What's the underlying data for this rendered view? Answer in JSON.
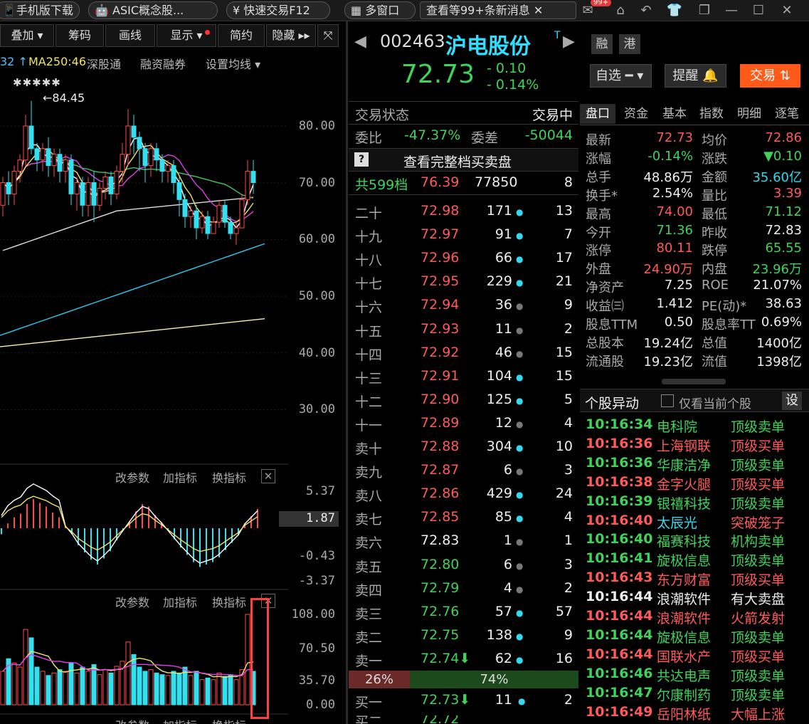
{
  "topbar": {
    "app_download": "手机版下载",
    "concept": "ASIC概念股...",
    "quick_trade": "快速交易F12",
    "multi_window": "多窗口",
    "messages": "查看等99+条新消息",
    "badge": "99+"
  },
  "toolbar": [
    "叠加 ▾",
    "筹码",
    "画线",
    "显示 ▾",
    "简约",
    "隐藏 ▸▸"
  ],
  "chart_header": {
    "ma_partial": "32 ↑",
    "ma250": "MA250:46",
    "sgt": "深股通",
    "margin": "融资融券",
    "set_ma": "设置均线 ▾"
  },
  "chart_data": {
    "type": "candlestick",
    "price_axis": [
      "80.00",
      "70.00",
      "60.00",
      "50.00",
      "40.00",
      "30.00"
    ],
    "high_marker": "84.45",
    "star_marks": "✱✱✱✱✱",
    "macd_axis": [
      "5.37",
      "1.87",
      "-0.43",
      "-3.37"
    ],
    "vol_axis": [
      "108.00",
      "70.50",
      "35.70",
      "0.00"
    ],
    "candles": [
      [
        66,
        70,
        64,
        71
      ],
      [
        70,
        68,
        66,
        72
      ],
      [
        68,
        72,
        66,
        73
      ],
      [
        72,
        74,
        70,
        75
      ],
      [
        74,
        80,
        73,
        82
      ],
      [
        80,
        76,
        75,
        84.45
      ],
      [
        76,
        74,
        72,
        77
      ],
      [
        74,
        76,
        72,
        77
      ],
      [
        76,
        73,
        71,
        78
      ],
      [
        73,
        75,
        71,
        76
      ],
      [
        75,
        72,
        70,
        76
      ],
      [
        72,
        74,
        70,
        75
      ],
      [
        74,
        68,
        66,
        75
      ],
      [
        68,
        70,
        65,
        71
      ],
      [
        70,
        66,
        64,
        71
      ],
      [
        66,
        70,
        64,
        71
      ],
      [
        70,
        66,
        63,
        72
      ],
      [
        66,
        69,
        65,
        70
      ],
      [
        69,
        71,
        67,
        72
      ],
      [
        71,
        68,
        66,
        72
      ],
      [
        68,
        72,
        67,
        73
      ],
      [
        72,
        75,
        70,
        77
      ],
      [
        75,
        80,
        73,
        83
      ],
      [
        80,
        78,
        75,
        82
      ],
      [
        78,
        76,
        72,
        79
      ],
      [
        76,
        73,
        70,
        77
      ],
      [
        73,
        76,
        71,
        77
      ],
      [
        76,
        74,
        72,
        77
      ],
      [
        74,
        72,
        70,
        75
      ],
      [
        72,
        73,
        70,
        74
      ],
      [
        73,
        70,
        68,
        74
      ],
      [
        70,
        67,
        64,
        71
      ],
      [
        67,
        64,
        62,
        68
      ],
      [
        64,
        65,
        62,
        66
      ],
      [
        65,
        62,
        60,
        66
      ],
      [
        62,
        64,
        61,
        65
      ],
      [
        64,
        61,
        60,
        65
      ],
      [
        61,
        63,
        61,
        64
      ],
      [
        63,
        66,
        62,
        67
      ],
      [
        66,
        63,
        62,
        67
      ],
      [
        63,
        61,
        60,
        64
      ],
      [
        61,
        62,
        59,
        63
      ],
      [
        62,
        67,
        62,
        68
      ],
      [
        67,
        72,
        66,
        74
      ],
      [
        72,
        70,
        68,
        74
      ]
    ],
    "volumes": [
      40,
      55,
      50,
      45,
      90,
      80,
      45,
      40,
      35,
      38,
      42,
      40,
      50,
      38,
      45,
      40,
      48,
      36,
      42,
      38,
      46,
      52,
      75,
      60,
      45,
      40,
      42,
      38,
      36,
      35,
      40,
      38,
      45,
      35,
      40,
      30,
      32,
      30,
      38,
      34,
      36,
      30,
      42,
      108,
      40
    ],
    "macd_hist": [
      -0.5,
      0.4,
      0.9,
      1.2,
      2.0,
      2.4,
      2.1,
      1.8,
      1.3,
      0.9,
      0.2,
      -0.5,
      -1.4,
      -2.0,
      -2.6,
      -3.0,
      -2.5,
      -1.9,
      -1.0,
      -0.2,
      0.6,
      1.4,
      2.0,
      1.8,
      1.1,
      0.5,
      -0.2,
      -0.9,
      -1.6,
      -2.2,
      -2.8,
      -3.2,
      -3.0,
      -2.8,
      -2.4,
      -1.8,
      -1.2,
      -0.6,
      0.4,
      1.0,
      1.6
    ]
  },
  "indicator_panel": {
    "params": "改参数",
    "add": "加指标",
    "swap": "换指标",
    "close": "✕"
  },
  "stock": {
    "code": "002463",
    "name": "沪电股份",
    "tag": "T",
    "price": "72.73",
    "change": "- 0.10",
    "pct": "- 0.14%",
    "tag_rong": "融",
    "tag_gang": "港"
  },
  "buttons": {
    "watch": "自选",
    "alert": "提醒",
    "trade": "交易"
  },
  "order_head": {
    "status_label": "交易状态",
    "status": "交易中",
    "wb_label": "委比",
    "wb": "-47.37%",
    "wc_label": "委差",
    "wc": "-50044",
    "q": "?",
    "full_book": "查看完整档买卖盘",
    "levels_label": "共599档",
    "levels_price": "76.39",
    "levels_vol": "77850",
    "levels_n": "8"
  },
  "asks": [
    {
      "lv": "二十",
      "p": "72.98",
      "v": "171",
      "n": "13"
    },
    {
      "lv": "十九",
      "p": "72.97",
      "v": "91",
      "n": "7"
    },
    {
      "lv": "十八",
      "p": "72.96",
      "v": "66",
      "n": "17"
    },
    {
      "lv": "十七",
      "p": "72.95",
      "v": "229",
      "n": "21"
    },
    {
      "lv": "十六",
      "p": "72.94",
      "v": "36",
      "n": "9"
    },
    {
      "lv": "十五",
      "p": "72.93",
      "v": "11",
      "n": "2"
    },
    {
      "lv": "十四",
      "p": "72.92",
      "v": "46",
      "n": "15"
    },
    {
      "lv": "十三",
      "p": "72.91",
      "v": "104",
      "n": "15"
    },
    {
      "lv": "十二",
      "p": "72.90",
      "v": "125",
      "n": "5"
    },
    {
      "lv": "十一",
      "p": "72.89",
      "v": "12",
      "n": "4"
    },
    {
      "lv": "卖十",
      "p": "72.88",
      "v": "304",
      "n": "10"
    },
    {
      "lv": "卖九",
      "p": "72.87",
      "v": "6",
      "n": "3"
    },
    {
      "lv": "卖八",
      "p": "72.86",
      "v": "429",
      "n": "24"
    },
    {
      "lv": "卖七",
      "p": "72.85",
      "v": "85",
      "n": "4"
    },
    {
      "lv": "卖六",
      "p": "72.83",
      "v": "1",
      "n": "1"
    },
    {
      "lv": "卖五",
      "p": "72.80",
      "v": "6",
      "n": "3"
    },
    {
      "lv": "卖四",
      "p": "72.79",
      "v": "4",
      "n": "2"
    },
    {
      "lv": "卖三",
      "p": "72.76",
      "v": "57",
      "n": "57"
    },
    {
      "lv": "卖二",
      "p": "72.75",
      "v": "138",
      "n": "9"
    },
    {
      "lv": "卖一",
      "p": "72.74⬇",
      "v": "62",
      "n": "16"
    }
  ],
  "ratio": {
    "sell": "26%",
    "buy": "74%"
  },
  "bid1": {
    "lv": "买一",
    "p": "72.73⬇",
    "v": "11",
    "n": "2"
  },
  "tabs": [
    "盘口",
    "资金",
    "基本",
    "指数",
    "明细",
    "逐笔"
  ],
  "quote": [
    [
      "最新",
      "72.73",
      "均价",
      "72.86"
    ],
    [
      "涨幅",
      "-0.14%",
      "涨跌",
      "▼0.10"
    ],
    [
      "总手",
      "48.86万",
      "金额",
      "35.60亿"
    ],
    [
      "换手*",
      "2.54%",
      "量比",
      "3.39"
    ],
    [
      "最高",
      "74.00",
      "最低",
      "71.12"
    ],
    [
      "今开",
      "71.36",
      "昨收",
      "72.83"
    ],
    [
      "涨停",
      "80.11",
      "跌停",
      "65.55"
    ],
    [
      "外盘",
      "24.90万",
      "内盘",
      "23.96万"
    ],
    [
      "净资产",
      "7.25",
      "ROE",
      "21.07%"
    ],
    [
      "收益㈢",
      "1.412",
      "PE(动)*",
      "38.63"
    ],
    [
      "股息TTM",
      "0.50",
      "股息率TTM",
      "0.69%"
    ],
    [
      "总股本",
      "19.24亿",
      "总值",
      "1400亿"
    ],
    [
      "流通股",
      "19.23亿",
      "流值",
      "1398亿"
    ]
  ],
  "alerts_head": {
    "title": "个股异动",
    "only_current": "仅看当前个股",
    "set": "设"
  },
  "alerts": [
    [
      "10:16:34",
      "电科院",
      "顶级卖单"
    ],
    [
      "10:16:36",
      "上海钢联",
      "顶级买单"
    ],
    [
      "10:16:36",
      "华康洁净",
      "顶级卖单"
    ],
    [
      "10:16:38",
      "金字火腿",
      "顶级买单"
    ],
    [
      "10:16:39",
      "银禧科技",
      "顶级卖单"
    ],
    [
      "10:16:40",
      "太辰光",
      "突破笼子"
    ],
    [
      "10:16:40",
      "福赛科技",
      "机构卖单"
    ],
    [
      "10:16:41",
      "旋极信息",
      "顶级卖单"
    ],
    [
      "10:16:43",
      "东方财富",
      "顶级买单"
    ],
    [
      "10:16:44",
      "浪潮软件",
      "有大卖盘"
    ],
    [
      "10:16:44",
      "浪潮软件",
      "火箭发射"
    ],
    [
      "10:16:44",
      "旋极信息",
      "顶级卖单"
    ],
    [
      "10:16:44",
      "国联水产",
      "顶级买单"
    ],
    [
      "10:16:46",
      "共达电声",
      "顶级卖单"
    ],
    [
      "10:16:47",
      "尔康制药",
      "顶级卖单"
    ],
    [
      "10:16:49",
      "岳阳林纸",
      "大幅上涨"
    ]
  ]
}
